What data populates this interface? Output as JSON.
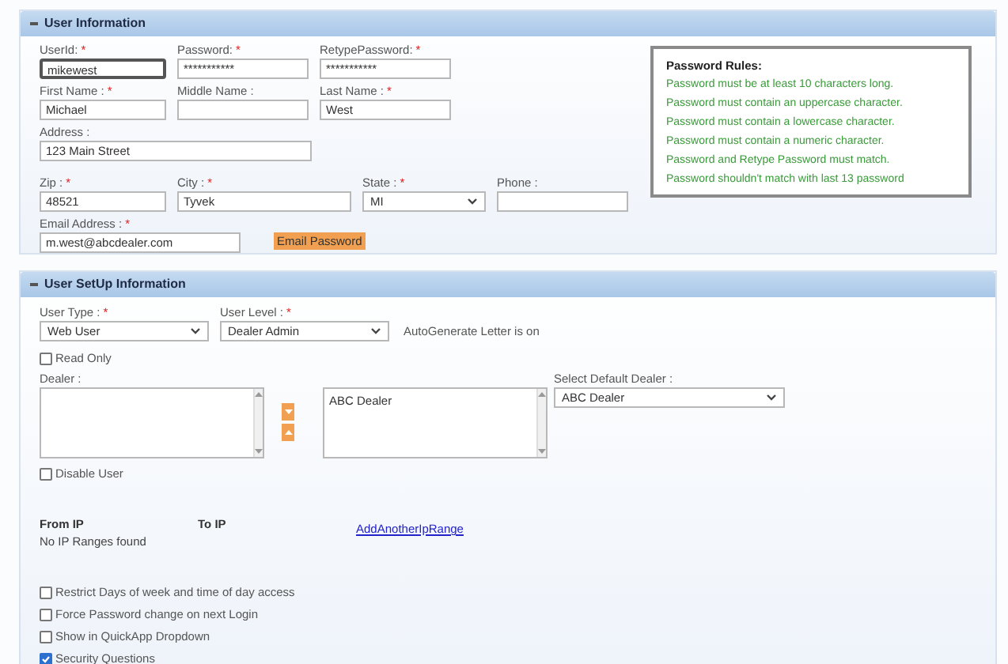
{
  "user_info": {
    "title": "User Information",
    "rows": [
      [
        {
          "label": "UserId:",
          "mark": "*",
          "kind": "text",
          "value": "mikewest",
          "focused": true
        },
        {
          "label": "Password:",
          "mark": "*",
          "kind": "text",
          "value": "***********"
        },
        {
          "label": "RetypePassword:",
          "mark": "*",
          "kind": "text",
          "value": "***********"
        }
      ],
      [
        {
          "label": "First Name :",
          "mark": "*",
          "kind": "text",
          "value": "Michael"
        },
        {
          "label": "Middle Name :",
          "kind": "text"
        },
        {
          "label": "Last Name :",
          "mark": "*",
          "kind": "text",
          "value": "West"
        }
      ],
      [
        {
          "label": "Address :",
          "kind": "text",
          "value": "123 Main Street"
        }
      ],
      [
        {
          "label": "Zip :",
          "mark": "*",
          "kind": "text",
          "value": "48521"
        },
        {
          "label": "City :",
          "mark": "*",
          "kind": "text",
          "value": "Tyvek"
        },
        {
          "label": "State :",
          "mark": "*",
          "kind": "select",
          "value": "MI"
        },
        {
          "label": "Phone :",
          "kind": "text"
        }
      ],
      [
        {
          "label": "Email Address :",
          "mark": "*",
          "kind": "text",
          "value": "m.west@abcdealer.com"
        }
      ]
    ],
    "email_button": "Email Password",
    "rules": {
      "title": "Password Rules:",
      "items": [
        "Password must be at least 10 characters long.",
        "Password must contain an uppercase character.",
        "Password must contain a lowercase character.",
        "Password must contain a numeric character.",
        "Password and Retype Password must match.",
        "Password shouldn't match with last 13 password"
      ]
    }
  },
  "setup": {
    "title": "User SetUp Information",
    "user_type": {
      "label": "User Type :",
      "mark": "*",
      "value": "Web User"
    },
    "user_level": {
      "label": "User Level :",
      "mark": "*",
      "value": "Dealer Admin"
    },
    "auto_note": "AutoGenerate Letter is on",
    "read_only": {
      "label": "Read Only",
      "checked": false
    },
    "dealer_label": "Dealer :",
    "assigned_dealers": [
      "ABC Dealer"
    ],
    "default_dealer": {
      "label": "Select Default Dealer :",
      "value": "ABC Dealer"
    },
    "disable_user": {
      "label": "Disable User",
      "checked": false
    },
    "ip": {
      "columns": [
        "From IP",
        "To IP"
      ],
      "empty": "No IP Ranges found",
      "link": "AddAnotherIpRange"
    },
    "options": [
      {
        "label": "Restrict Days of week and time of day access",
        "checked": false
      },
      {
        "label": "Force Password change on next Login",
        "checked": false
      },
      {
        "label": "Show in QuickApp Dropdown",
        "checked": false
      },
      {
        "label": "Security Questions",
        "checked": true
      }
    ]
  }
}
